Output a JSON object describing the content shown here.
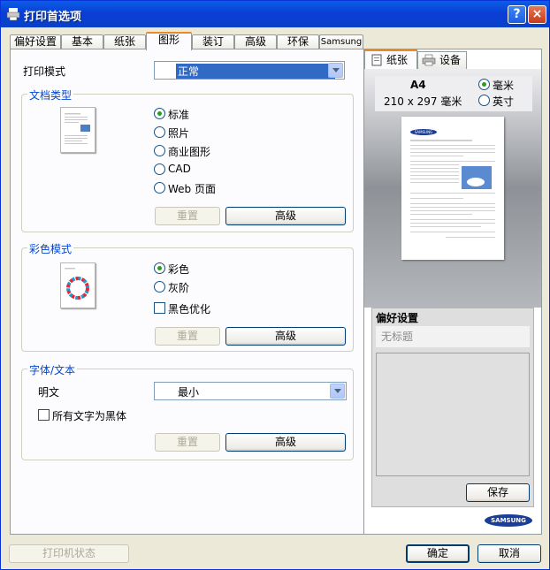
{
  "window": {
    "title": "打印首选项",
    "help_btn": "?",
    "close_btn": "×"
  },
  "tabs": [
    "偏好设置",
    "基本",
    "纸张",
    "图形",
    "装订",
    "高级",
    "环保",
    "Samsung"
  ],
  "active_tab": 3,
  "print_mode": {
    "label": "打印模式",
    "value": "正常"
  },
  "doc_type": {
    "title": "文档类型",
    "options": [
      "标准",
      "照片",
      "商业图形",
      "CAD",
      "Web 页面"
    ],
    "selected": 0,
    "reset": "重置",
    "advanced": "高级"
  },
  "color_mode": {
    "title": "彩色模式",
    "options": [
      "彩色",
      "灰阶"
    ],
    "selected": 0,
    "black_opt": "黑色优化",
    "reset": "重置",
    "advanced": "高级"
  },
  "font": {
    "title": "字体/文本",
    "plain_label": "明文",
    "plain_value": "最小",
    "all_black": "所有文字为黑体",
    "reset": "重置",
    "advanced": "高级"
  },
  "right_panel": {
    "tab_paper": "纸张",
    "tab_device": "设备",
    "paper_size": "A4",
    "paper_dims": "210 x 297 毫米",
    "unit_mm": "毫米",
    "unit_inch": "英寸",
    "page_brand": "SAMSUNG",
    "fav_title": "偏好设置",
    "fav_name": "无标题",
    "save": "保存",
    "brand_logo": "SAMSUNG"
  },
  "footer": {
    "printer_status": "打印机状态",
    "ok": "确定",
    "cancel": "取消"
  },
  "colors": {
    "title_bar": "#0a3ed6",
    "group_title": "#0046d5",
    "active_tab_top": "#e68b2c",
    "selection": "#316ac5"
  }
}
